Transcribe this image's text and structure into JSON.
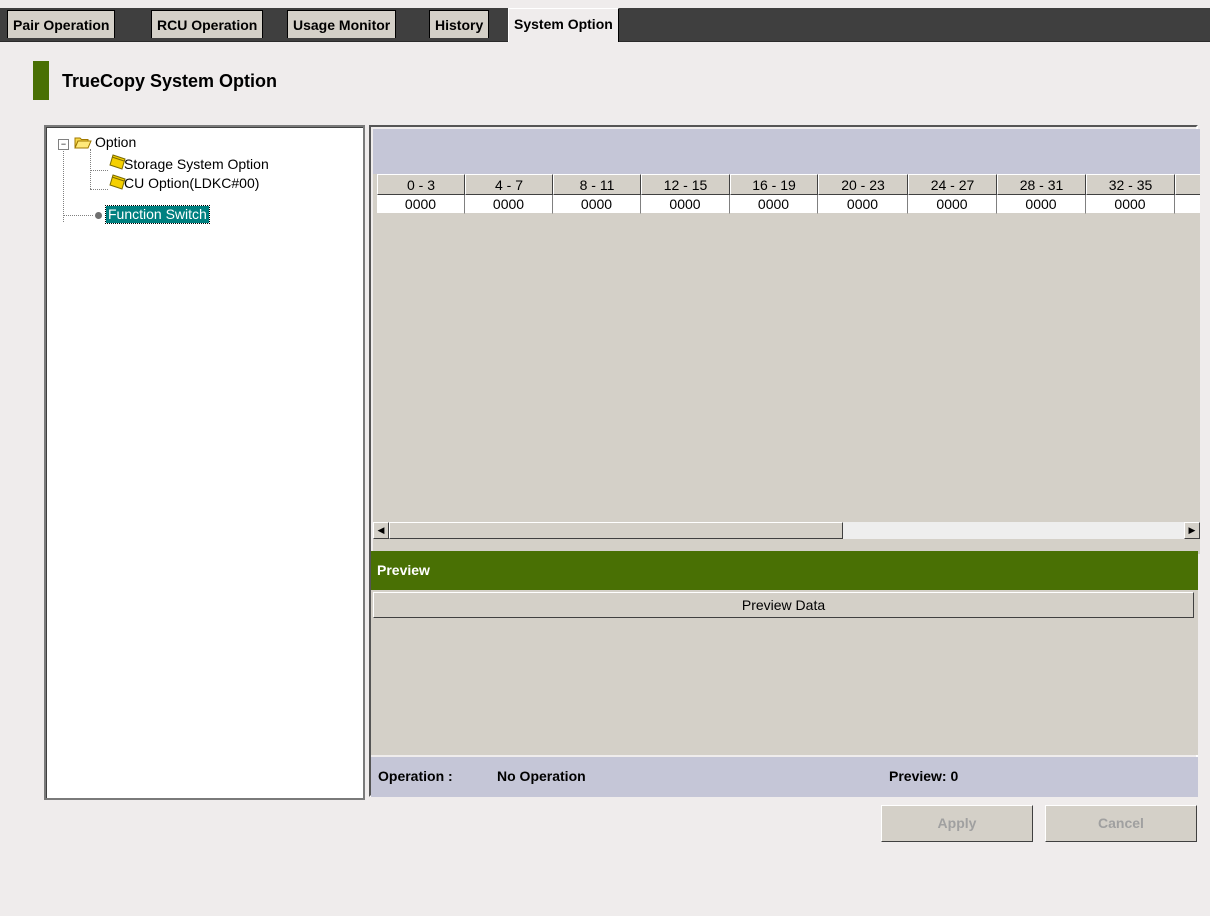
{
  "tabs": [
    {
      "label": "Pair Operation",
      "active": false
    },
    {
      "label": "RCU Operation",
      "active": false
    },
    {
      "label": "Usage Monitor",
      "active": false
    },
    {
      "label": "History",
      "active": false
    },
    {
      "label": "System Option",
      "active": true
    }
  ],
  "page_title": "TrueCopy System Option",
  "tree": {
    "root": {
      "label": "Option",
      "icon": "folder-open-icon",
      "expanded": true
    },
    "children": [
      {
        "label": "Storage System Option",
        "icon": "document-icon"
      },
      {
        "label": "CU Option(LDKC#00)",
        "icon": "document-icon"
      }
    ],
    "function_switch": {
      "label": "Function Switch",
      "icon": "dot-icon",
      "selected": true
    }
  },
  "table": {
    "columns": [
      "0 - 3",
      "4 - 7",
      "8 - 11",
      "12 - 15",
      "16 - 19",
      "20 - 23",
      "24 - 27",
      "28 - 31",
      "32 - 35"
    ],
    "rows": [
      [
        "0000",
        "0000",
        "0000",
        "0000",
        "0000",
        "0000",
        "0000",
        "0000",
        "0000"
      ]
    ]
  },
  "preview": {
    "title": "Preview",
    "column": "Preview Data"
  },
  "status": {
    "operation_label": "Operation :",
    "operation_value": "No Operation",
    "preview_count": "Preview: 0"
  },
  "buttons": {
    "apply": "Apply",
    "cancel": "Cancel"
  },
  "colors": {
    "accent_green": "#497004",
    "band_blue_gray": "#c5c6d7",
    "selection_teal": "#008080"
  }
}
